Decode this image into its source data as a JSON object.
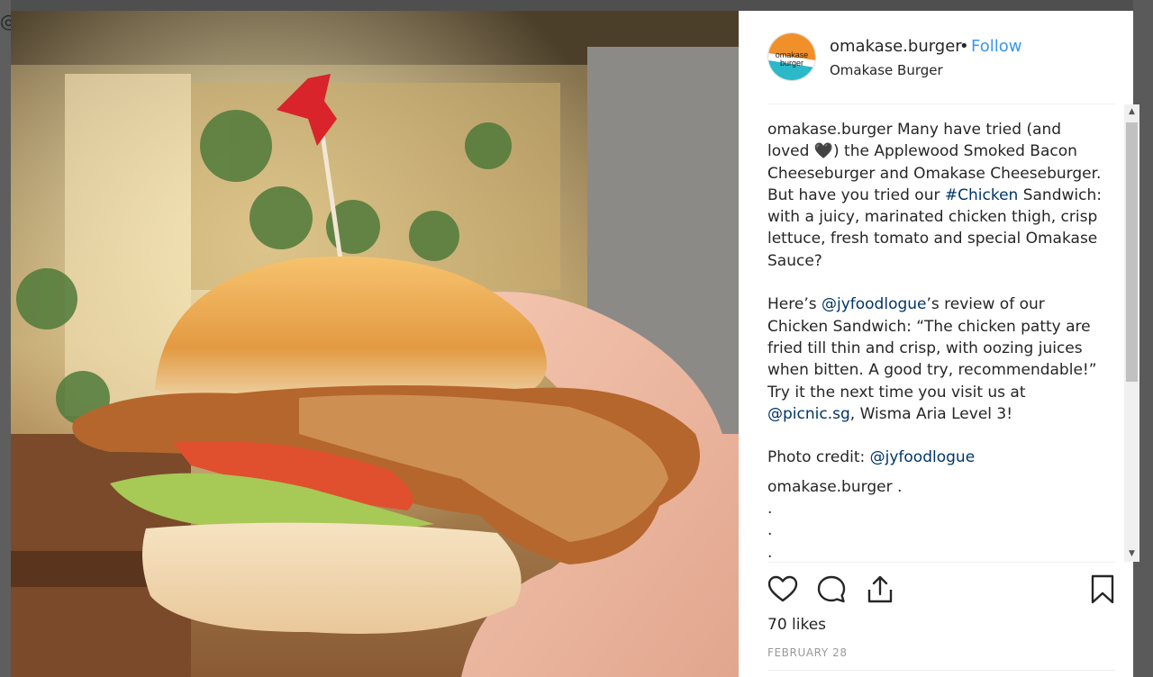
{
  "post": {
    "username": "omakase.burger",
    "dot": "•",
    "follow_label": "Follow",
    "subtitle": "Omakase Burger",
    "avatar_text_1": "omakase",
    "avatar_text_2": "burger",
    "caption": {
      "user": "omakase.burger",
      "line_a": "Many have tried (and loved",
      "heart": "🖤",
      "line_b": ") the Applewood Smoked Bacon Cheeseburger and Omakase Cheeseburger. But have you tried our",
      "hashtag": "#Chicken",
      "line_c": "Sandwich: with a juicy, marinated chicken thigh, crisp lettuce, fresh tomato and special Omakase Sauce?",
      "p2_a": "Here’s",
      "p2_mention": "@jyfoodlogue",
      "p2_b": "’s review of our Chicken Sandwich: “The chicken patty are fried till thin and crisp, with oozing juices when bitten. A good try, recommendable!” Try it the next time you visit us at",
      "p2_mention2": "@picnic.sg",
      "p2_c": ", Wisma Aria Level 3!",
      "p3_a": "Photo credit:",
      "p3_mention": "@jyfoodlogue",
      "comment_user": "omakase.burger",
      "comment_text": ".",
      "dots": [
        ".",
        ".",
        "."
      ]
    },
    "likes": "70 likes",
    "date": "FEBRUARY 28"
  },
  "icons": {
    "like": "heart-icon",
    "comment": "comment-icon",
    "share": "share-icon",
    "save": "bookmark-icon"
  },
  "colors": {
    "follow": "#3897f0",
    "link": "#003569",
    "avatar_orange": "#f0902a",
    "avatar_teal": "#2bb8c9"
  }
}
